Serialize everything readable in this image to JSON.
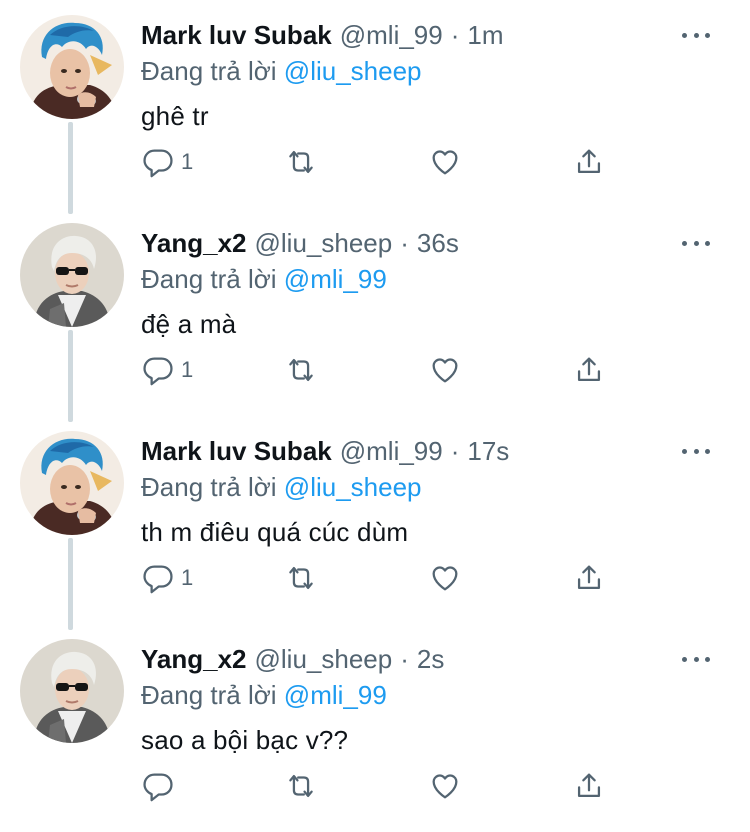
{
  "reply_prefix": "Đang trả lời",
  "tweets": [
    {
      "display_name": "Mark luv Subak",
      "handle": "@mli_99",
      "time": "1m",
      "reply_to": "@liu_sheep",
      "text": "ghê tr",
      "reply_count": "1",
      "avatar": "blue-hair-avatar"
    },
    {
      "display_name": "Yang_x2",
      "handle": "@liu_sheep",
      "time": "36s",
      "reply_to": "@mli_99",
      "text": "đệ a mà",
      "reply_count": "1",
      "avatar": "silver-hair-sunglasses-avatar"
    },
    {
      "display_name": "Mark luv Subak",
      "handle": "@mli_99",
      "time": "17s",
      "reply_to": "@liu_sheep",
      "text": "th m điêu quá cúc dùm",
      "reply_count": "1",
      "avatar": "blue-hair-avatar"
    },
    {
      "display_name": "Yang_x2",
      "handle": "@liu_sheep",
      "time": "2s",
      "reply_to": "@mli_99",
      "text": "sao a bội bạc v??",
      "reply_count": "",
      "avatar": "silver-hair-sunglasses-avatar"
    }
  ],
  "colors": {
    "text_primary": "#0f1419",
    "text_secondary": "#536471",
    "link": "#1d9bf0",
    "thread_line": "#cfd9de"
  },
  "icons": [
    "reply-icon",
    "retweet-icon",
    "like-icon",
    "share-icon",
    "more-icon"
  ]
}
